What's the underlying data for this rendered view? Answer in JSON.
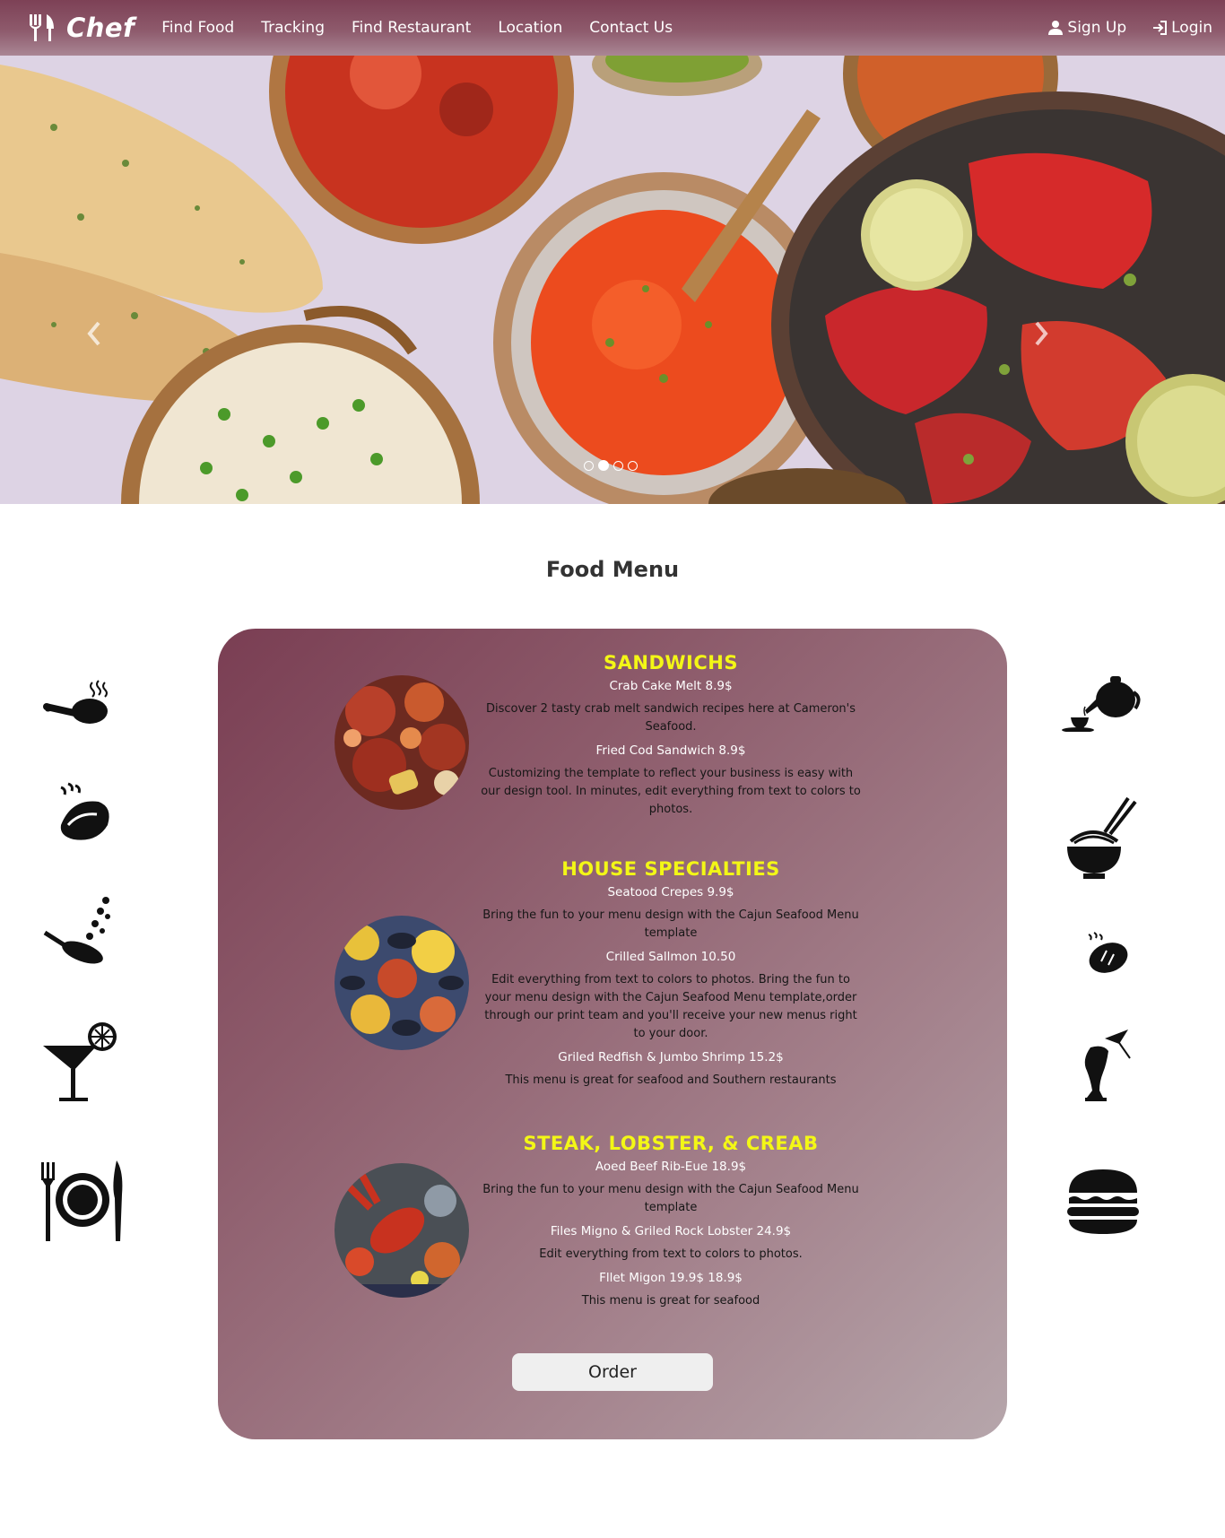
{
  "brand": {
    "name": "Chef",
    "icon": "fork-knife-icon"
  },
  "nav": {
    "links": [
      "Find Food",
      "Tracking",
      "Find Restaurant",
      "Location",
      "Contact Us"
    ],
    "signup_label": "Sign Up",
    "login_label": "Login"
  },
  "carousel": {
    "slides": 4,
    "active_slide": 2
  },
  "menu": {
    "title": "Food Menu",
    "sections": [
      {
        "heading": "SANDWICHS",
        "items": [
          {
            "name": "Crab Cake Melt 8.9$",
            "desc": "Discover 2 tasty crab melt sandwich recipes here at Cameron's Seafood."
          },
          {
            "name": "Fried Cod Sandwich 8.9$",
            "desc": "Customizing the template to reflect your business is easy with our design tool. In minutes, edit everything from text to colors to photos."
          }
        ]
      },
      {
        "heading": "HOUSE SPECIALTIES",
        "items": [
          {
            "name": "Seatood Crepes 9.9$",
            "desc": "Bring the fun to your menu design with the Cajun Seafood Menu template"
          },
          {
            "name": "Crilled Sallmon 10.50",
            "desc": "Edit everything from text to colors to photos. Bring the fun to your menu design with the Cajun Seafood Menu template,order through our print team and you'll receive your new menus right to your door."
          },
          {
            "name": "Griled Redfish & Jumbo Shrimp 15.2$",
            "desc": "This menu is great for seafood and Southern restaurants"
          }
        ]
      },
      {
        "heading": "STEAK, LOBSTER, & CREAB",
        "items": [
          {
            "name": "Aoed Beef Rib-Eue 18.9$",
            "desc": "Bring the fun to your menu design with the Cajun Seafood Menu template"
          },
          {
            "name": "Files Migno & Griled Rock Lobster 24.9$",
            "desc": "Edit everything from text to colors to photos."
          },
          {
            "name": "Fllet Migon 19.9$ 18.9$",
            "desc": "This menu is great for seafood"
          }
        ]
      }
    ],
    "order_label": "Order"
  },
  "side_icons_left": [
    "chicken-leg-icon",
    "steaming-dish-icon",
    "frying-pan-icon",
    "cocktail-icon",
    "plate-cutlery-icon"
  ],
  "side_icons_right": [
    "teapot-icon",
    "noodle-bowl-icon",
    "bread-icon",
    "tropical-drink-icon",
    "burger-icon"
  ],
  "colors": {
    "navbar": "#8e5a6c",
    "card_start": "#7a3e53",
    "card_end": "#b6a6ab",
    "heading": "#f3f716"
  }
}
